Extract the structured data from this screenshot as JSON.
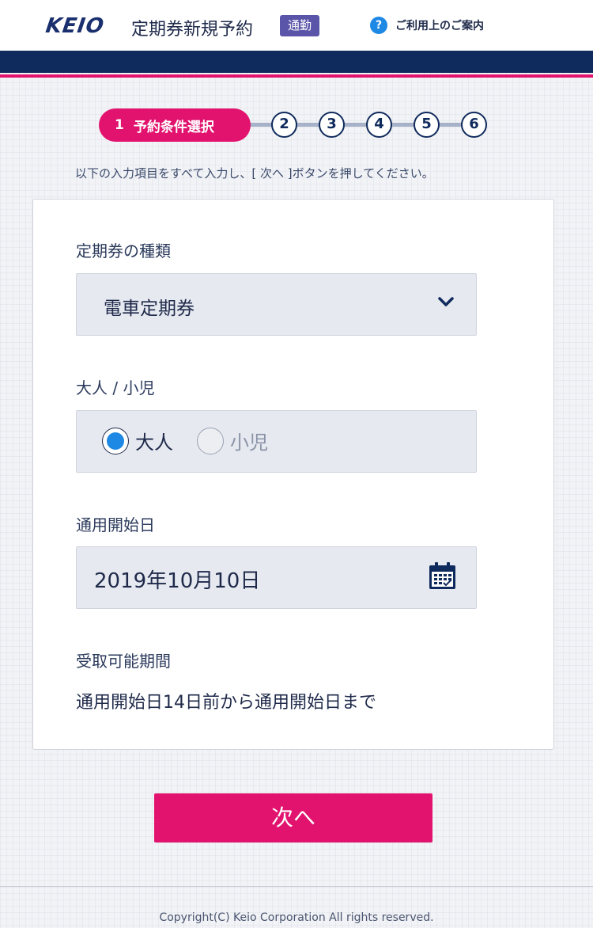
{
  "header": {
    "logo": "KEIO",
    "title": "定期券新規予約",
    "badge": "通勤",
    "help_label": "ご利用上のご案内"
  },
  "stepper": {
    "active": {
      "number": "1",
      "label": "予約条件選択"
    },
    "steps": [
      "2",
      "3",
      "4",
      "5",
      "6"
    ]
  },
  "instructions": "以下の入力項目をすべて入力し、[ 次へ ]ボタンを押してください。",
  "form": {
    "pass_type": {
      "label": "定期券の種類",
      "value": "電車定期券"
    },
    "passenger": {
      "label": "大人 / 小児",
      "options": [
        {
          "label": "大人",
          "checked": true
        },
        {
          "label": "小児",
          "checked": false
        }
      ]
    },
    "start_date": {
      "label": "通用開始日",
      "value": "2019年10月10日"
    },
    "pickup": {
      "label": "受取可能期間",
      "value": "通用開始日14日前から通用開始日まで"
    }
  },
  "next_label": "次へ",
  "footer": {
    "copyright": "Copyright(C) Keio Corporation All rights reserved."
  },
  "colors": {
    "brand_pink": "#e2136e",
    "navy": "#0f2a5c",
    "badge": "#5a55a8",
    "radio": "#1e88e5"
  }
}
